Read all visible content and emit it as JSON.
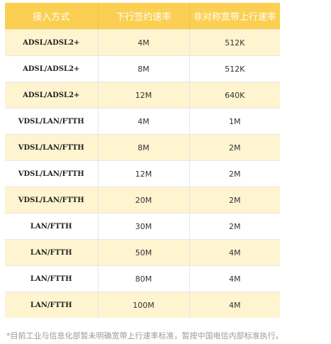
{
  "table": {
    "headers": [
      "接入方式",
      "下行签约速率",
      "非对称宽带上行速率"
    ],
    "rows": [
      [
        "ADSL/ADSL2+",
        "4M",
        "512K"
      ],
      [
        "ADSL/ADSL2+",
        "8M",
        "512K"
      ],
      [
        "ADSL/ADSL2+",
        "12M",
        "640K"
      ],
      [
        "VDSL/LAN/FTTH",
        "4M",
        "1M"
      ],
      [
        "VDSL/LAN/FTTH",
        "8M",
        "2M"
      ],
      [
        "VDSL/LAN/FTTH",
        "12M",
        "2M"
      ],
      [
        "VDSL/LAN/FTTH",
        "20M",
        "2M"
      ],
      [
        "LAN/FTTH",
        "30M",
        "2M"
      ],
      [
        "LAN/FTTH",
        "50M",
        "4M"
      ],
      [
        "LAN/FTTH",
        "80M",
        "4M"
      ],
      [
        "LAN/FTTH",
        "100M",
        "4M"
      ]
    ]
  },
  "footnote": "*目前工业与信息化部暂未明确宽带上行速率标准，暂按中国电信内部标准执行。",
  "colors": {
    "header_bg": "#fbcf51",
    "header_text": "#ffffff",
    "row_odd_bg": "#fff4d0",
    "row_even_bg": "#ffffff",
    "footnote_text": "#999999"
  }
}
